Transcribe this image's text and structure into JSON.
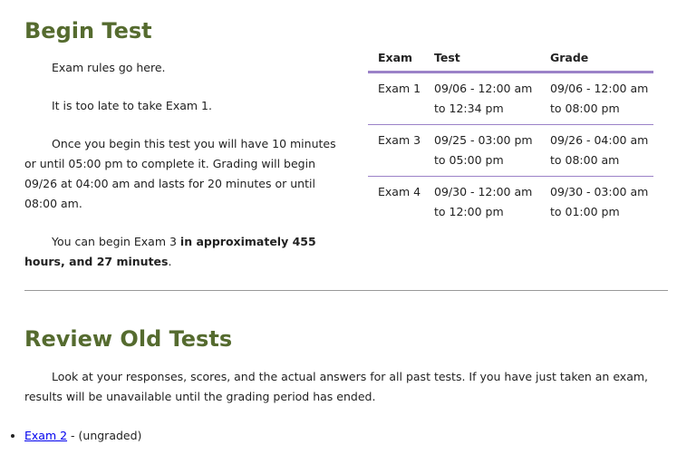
{
  "begin": {
    "title": "Begin Test",
    "rules": "Exam rules go here.",
    "late": "It is too late to take Exam 1.",
    "info": "Once you begin this test you will have 10 minutes or until 05:00 pm to complete it. Grading will begin 09/26 at 04:00 am and lasts for 20 minutes or until 08:00 am.",
    "next_prefix": "You can begin Exam 3 ",
    "next_bold": "in approximately 455 hours, and 27 minutes",
    "next_suffix": "."
  },
  "schedule": {
    "headers": [
      "Exam",
      "Test",
      "Grade"
    ],
    "rows": [
      {
        "exam": "Exam 1",
        "test": "09/06 - 12:00 am to 12:34 pm",
        "grade": "09/06 - 12:00 am to 08:00 pm"
      },
      {
        "exam": "Exam 3",
        "test": "09/25 - 03:00 pm to 05:00 pm",
        "grade": "09/26 - 04:00 am to 08:00 am"
      },
      {
        "exam": "Exam 4",
        "test": "09/30 - 12:00 am to 12:00 pm",
        "grade": "09/30 - 03:00 am to 01:00 pm"
      }
    ]
  },
  "review": {
    "title": "Review Old Tests",
    "text": "Look at your responses, scores, and the actual answers for all past tests. If you have just taken an exam, results will be unavailable until the grading period has ended.",
    "items": [
      {
        "link": "Exam 2",
        "status": " - (ungraded)"
      }
    ]
  }
}
